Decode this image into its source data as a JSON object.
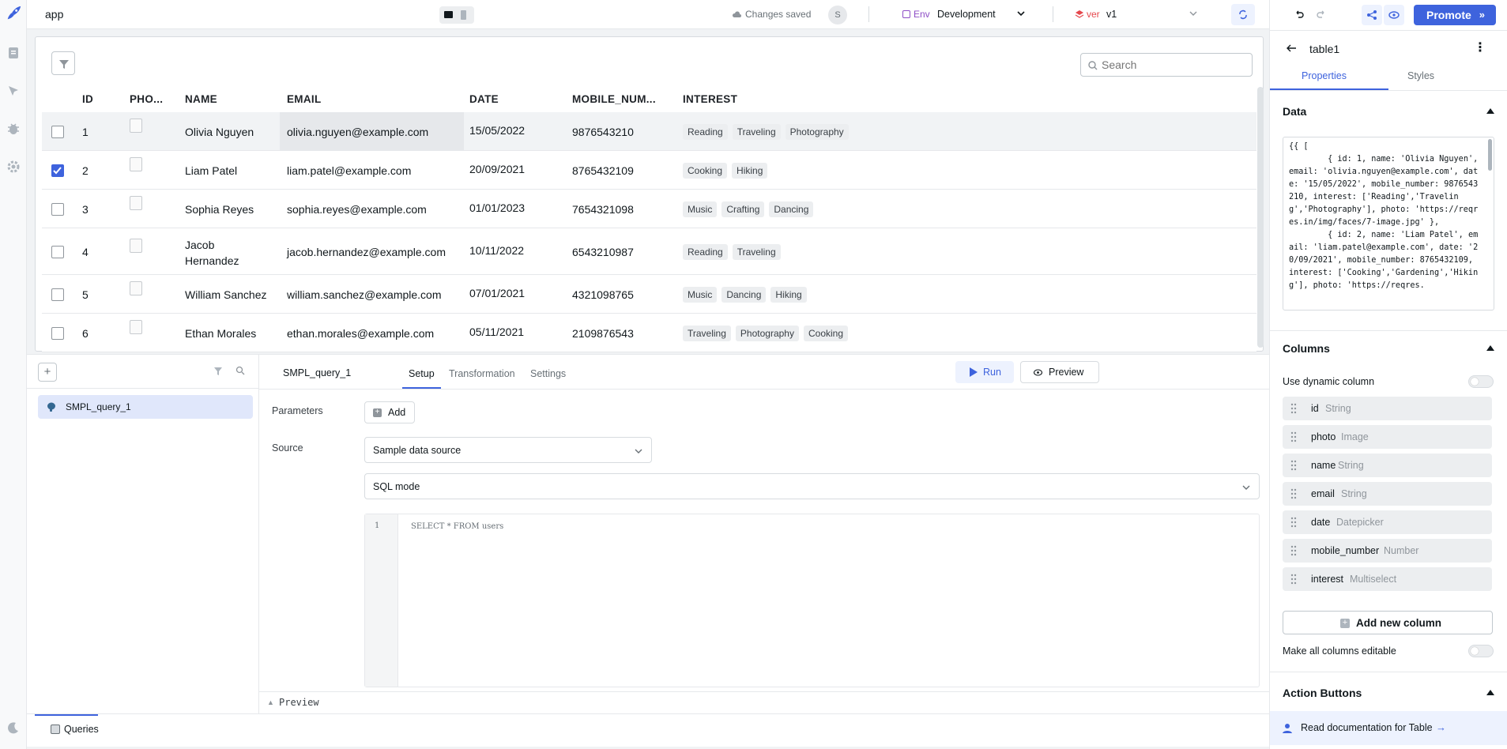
{
  "app": {
    "name": "app",
    "status": "Changes saved",
    "avatar": "S"
  },
  "env": {
    "label": "Env",
    "value": "Development"
  },
  "version": {
    "label": "ver",
    "value": "v1"
  },
  "promote_label": "Promote",
  "search": {
    "placeholder": "Search"
  },
  "table": {
    "headers": [
      "ID",
      "PHO...",
      "NAME",
      "EMAIL",
      "DATE",
      "MOBILE_NUM...",
      "INTEREST"
    ],
    "rows": [
      {
        "id": "1",
        "name": "Olivia Nguyen",
        "email": "olivia.nguyen@example.com",
        "date": "15/05/2022",
        "mobile": "9876543210",
        "interests": [
          "Reading",
          "Traveling",
          "Photography"
        ],
        "checked": false
      },
      {
        "id": "2",
        "name": "Liam Patel",
        "email": "liam.patel@example.com",
        "date": "20/09/2021",
        "mobile": "8765432109",
        "interests": [
          "Cooking",
          "Hiking"
        ],
        "checked": true
      },
      {
        "id": "3",
        "name": "Sophia Reyes",
        "email": "sophia.reyes@example.com",
        "date": "01/01/2023",
        "mobile": "7654321098",
        "interests": [
          "Music",
          "Crafting",
          "Dancing"
        ],
        "checked": false
      },
      {
        "id": "4",
        "name": "Jacob Hernandez",
        "email": "jacob.hernandez@example.com",
        "date": "10/11/2022",
        "mobile": "6543210987",
        "interests": [
          "Reading",
          "Traveling"
        ],
        "checked": false
      },
      {
        "id": "5",
        "name": "William Sanchez",
        "email": "william.sanchez@example.com",
        "date": "07/01/2021",
        "mobile": "4321098765",
        "interests": [
          "Music",
          "Dancing",
          "Hiking"
        ],
        "checked": false
      },
      {
        "id": "6",
        "name": "Ethan Morales",
        "email": "ethan.morales@example.com",
        "date": "05/11/2021",
        "mobile": "2109876543",
        "interests": [
          "Traveling",
          "Photography",
          "Cooking"
        ],
        "checked": false
      }
    ]
  },
  "queries": {
    "list": [
      {
        "name": "SMPL_query_1"
      }
    ],
    "active_name": "SMPL_query_1",
    "tabs": [
      "Setup",
      "Transformation",
      "Settings"
    ],
    "run_label": "Run",
    "preview_label": "Preview",
    "parameters_label": "Parameters",
    "add_label": "Add",
    "source_label": "Source",
    "source_value": "Sample data source",
    "mode_value": "SQL mode",
    "line_number": "1",
    "sql": "SELECT * FROM users",
    "preview_footer": "Preview",
    "bottom_tab": "Queries"
  },
  "inspector": {
    "component_name": "table1",
    "tabs": [
      "Properties",
      "Styles"
    ],
    "data_title": "Data",
    "data_code": "{{ [\n        { id: 1, name: 'Olivia Nguyen', email: 'olivia.nguyen@example.com', date: '15/05/2022', mobile_number: 9876543210, interest: ['Reading','Traveling','Photography'], photo: 'https://reqres.in/img/faces/7-image.jpg' },\n        { id: 2, name: 'Liam Patel', email: 'liam.patel@example.com', date: '20/09/2021', mobile_number: 8765432109, interest: ['Cooking','Gardening','Hiking'], photo: 'https://reqres.",
    "columns_title": "Columns",
    "dynamic_label": "Use dynamic column",
    "columns": [
      {
        "name": "id",
        "type": "String"
      },
      {
        "name": "photo",
        "type": "Image"
      },
      {
        "name": "name",
        "type": "String"
      },
      {
        "name": "email",
        "type": "String"
      },
      {
        "name": "date",
        "type": "Datepicker"
      },
      {
        "name": "mobile_number",
        "type": "Number"
      },
      {
        "name": "interest",
        "type": "Multiselect"
      }
    ],
    "add_column_label": "Add new column",
    "editable_label": "Make all columns editable",
    "action_title": "Action Buttons",
    "docs_label": "Read documentation for Table",
    "docs_arrow": "→"
  },
  "colors": {
    "accent": "#3e63dd",
    "selected_row": "#eceef0"
  }
}
